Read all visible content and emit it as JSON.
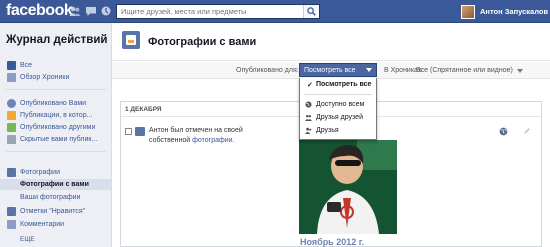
{
  "topbar": {
    "logo": "facebook",
    "search_placeholder": "Ищите друзей, места или предметы",
    "user_name": "Антон Запускалов"
  },
  "sidebar": {
    "title": "Журнал действий",
    "items": [
      {
        "label": "Все",
        "icon": "facebook-icon"
      },
      {
        "label": "Обзор Хроники",
        "icon": "timeline-icon"
      },
      {
        "label": "Опубликовано Вами",
        "icon": "person-icon"
      },
      {
        "label": "Публикации, в котор...",
        "icon": "posts-icon"
      },
      {
        "label": "Опубликовано другими",
        "icon": "friends-posts-icon"
      },
      {
        "label": "Скрытые вами публик...",
        "icon": "hidden-icon"
      },
      {
        "label": "Фотографии",
        "icon": "photos-icon"
      },
      {
        "label": "Фотографии с вами",
        "icon": ""
      },
      {
        "label": "Ваши фотографии",
        "icon": ""
      },
      {
        "label": "Отметки \"Нравится\"",
        "icon": "like-icon"
      },
      {
        "label": "Комментарии",
        "icon": "comment-icon"
      }
    ],
    "more_label": "ЕЩЕ"
  },
  "main": {
    "page_title": "Фотографии с вами",
    "filter_label": "Опубликовано для:",
    "filter_value": "Посмотреть все",
    "timeline_label": "В Хрониках:",
    "timeline_value": "Все (Спрятанное или видное)",
    "dropdown": {
      "checked": "Посмотреть все",
      "options": [
        {
          "label": "Доступно всем",
          "icon": "globe-icon"
        },
        {
          "label": "Друзья друзей",
          "icon": "friends-of-friends-icon"
        },
        {
          "label": "Друзья",
          "icon": "friends-icon"
        }
      ]
    },
    "card": {
      "date": "1 ДЕКАБРЯ",
      "story_text": "Антон был отмечен на своей собственной",
      "story_link": "фотографии",
      "story_end": "."
    },
    "month_marker": "Ноябрь 2012 г."
  },
  "colors": {
    "brand_blue": "#3b5998",
    "sidebar_bg": "#edeff4",
    "active_item_bg": "#d8dfea"
  }
}
